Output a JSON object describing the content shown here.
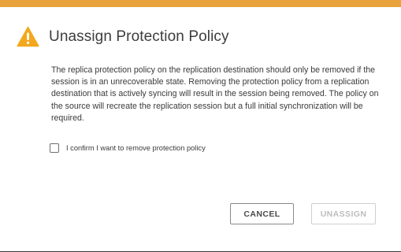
{
  "dialog": {
    "title": "Unassign Protection Policy",
    "icon": "warning-icon",
    "accent_color": "#e8a33c",
    "warning_color": "#f2a81d",
    "message": "The replica protection policy on the replication destination should only be removed if the session is in an unrecoverable state. Removing the protection policy from a replication destination that is actively syncing will result in the session being removed. The policy on the source will recreate the replication session but a full initial synchronization will be required.",
    "confirm": {
      "label": "I confirm I want to remove protection policy",
      "checked": false
    },
    "buttons": {
      "cancel_label": "CANCEL",
      "unassign_label": "UNASSIGN",
      "unassign_disabled": true
    }
  }
}
